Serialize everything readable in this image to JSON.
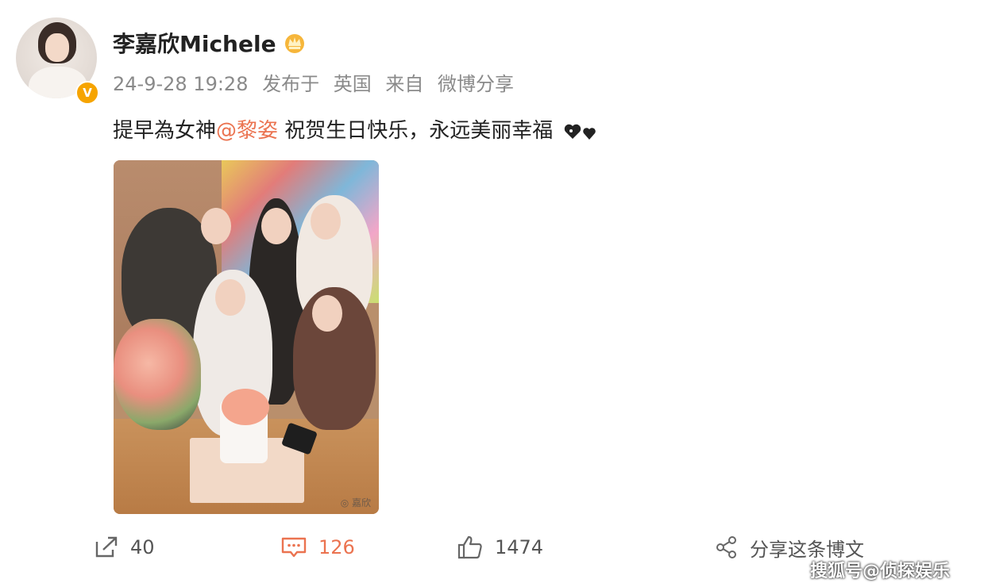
{
  "post": {
    "author": "李嘉欣Michele",
    "timestamp": "24-9-28 19:28",
    "published_label": "发布于",
    "location": "英国",
    "from_label": "来自",
    "source": "微博分享",
    "text_before": "提早為女神",
    "mention": "@黎姿",
    "text_after": " 祝贺生日快乐，永远美丽幸福",
    "photo_watermark": "◎ 嘉欣"
  },
  "actions": {
    "share_count": "40",
    "comment_count": "126",
    "like_count": "1474",
    "forward_label": "分享这条博文"
  },
  "source_watermark": "搜狐号@侦探娱乐",
  "colors": {
    "accent": "#eb7350",
    "verified": "#f6a400",
    "meta_text": "#8a8a8a"
  },
  "icons": {
    "share": "share-icon",
    "comment": "comment-icon",
    "like": "like-icon",
    "forward": "network-share-icon",
    "verified": "verified-badge-icon",
    "crown": "crown-icon",
    "hearts": "hearts-emoji-icon"
  }
}
